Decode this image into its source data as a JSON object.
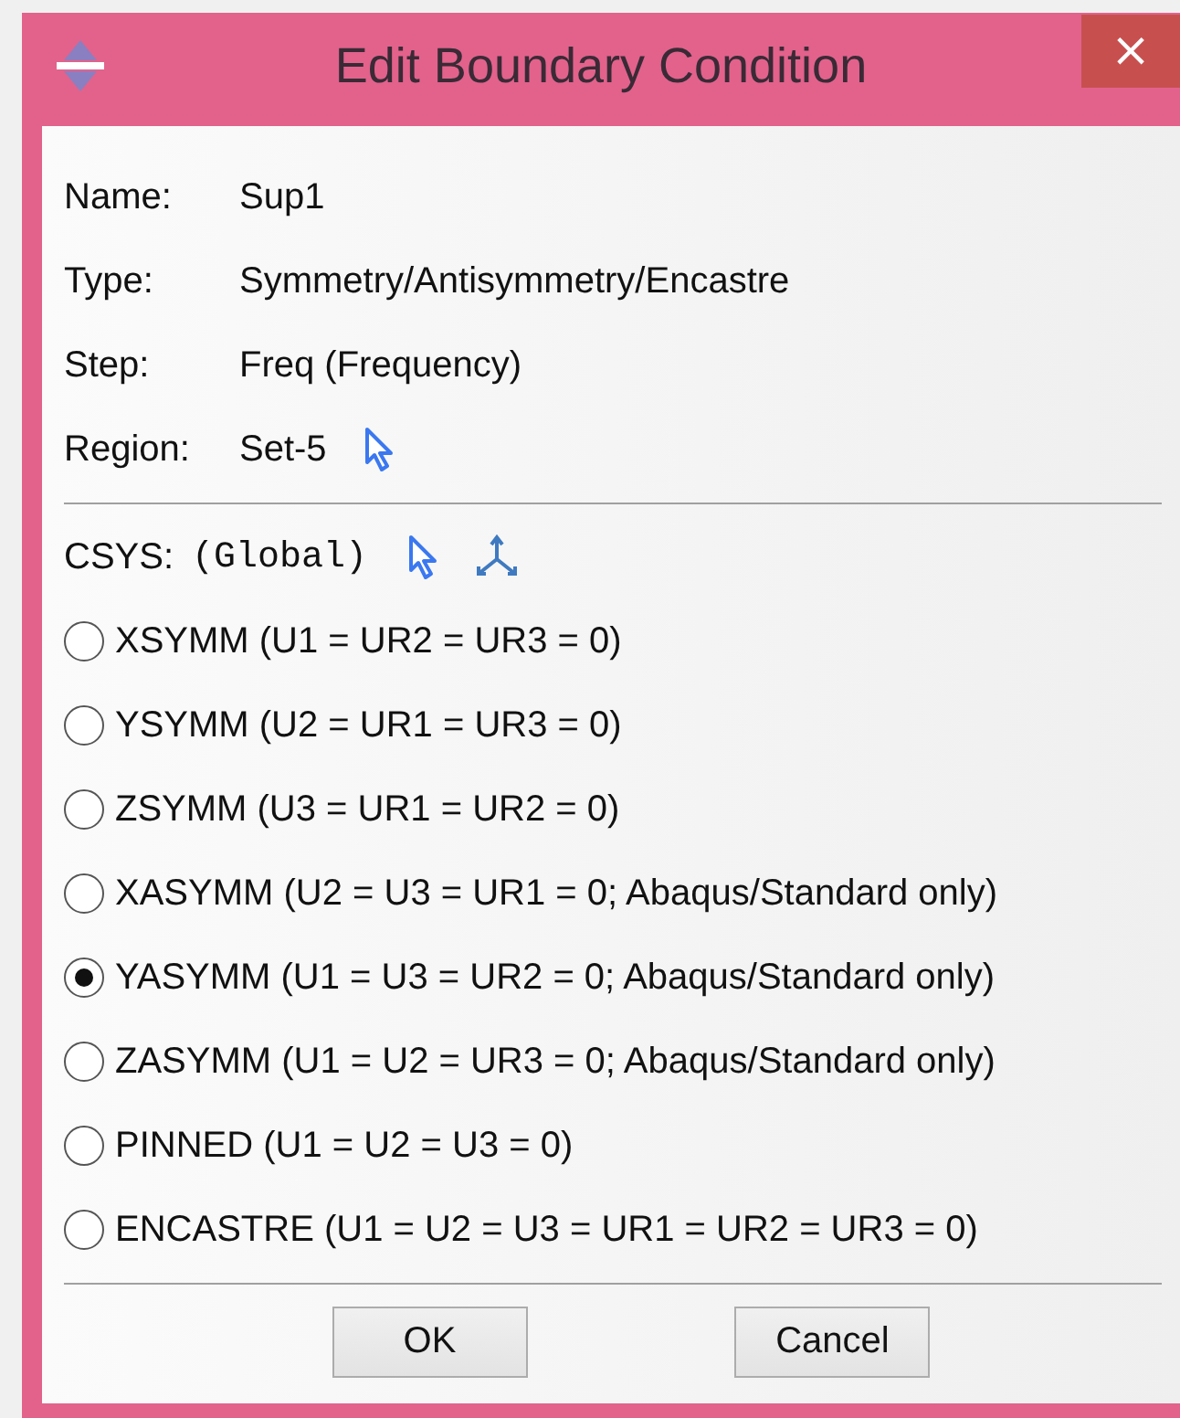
{
  "window": {
    "title": "Edit Boundary Condition",
    "close_button": "×"
  },
  "fields": [
    {
      "label": "Name:",
      "value": "Sup1",
      "kind": "text"
    },
    {
      "label": "Type:",
      "value": "Symmetry/Antisymmetry/Encastre",
      "kind": "text"
    },
    {
      "label": "Step:",
      "value": "Freq (Frequency)",
      "kind": "text"
    },
    {
      "label": "Region:",
      "value": "Set-5",
      "kind": "pick"
    }
  ],
  "csys": {
    "label": "CSYS:",
    "value": "(Global)"
  },
  "options": [
    {
      "label": "XSYMM (U1 = UR2 = UR3 = 0)",
      "selected": false
    },
    {
      "label": "YSYMM (U2 = UR1 = UR3 = 0)",
      "selected": false
    },
    {
      "label": "ZSYMM (U3 = UR1 = UR2 = 0)",
      "selected": false
    },
    {
      "label": "XASYMM (U2 = U3 = UR1 = 0; Abaqus/Standard only)",
      "selected": false
    },
    {
      "label": "YASYMM (U1 = U3 = UR2 = 0; Abaqus/Standard only)",
      "selected": true
    },
    {
      "label": "ZASYMM (U1 = U2 = UR3 = 0; Abaqus/Standard only)",
      "selected": false
    },
    {
      "label": "PINNED (U1 = U2 = U3 = 0)",
      "selected": false
    },
    {
      "label": "ENCASTRE (U1 = U2 = U3 = UR1 = UR2 = UR3 = 0)",
      "selected": false
    }
  ],
  "buttons": [
    "OK",
    "Cancel"
  ]
}
